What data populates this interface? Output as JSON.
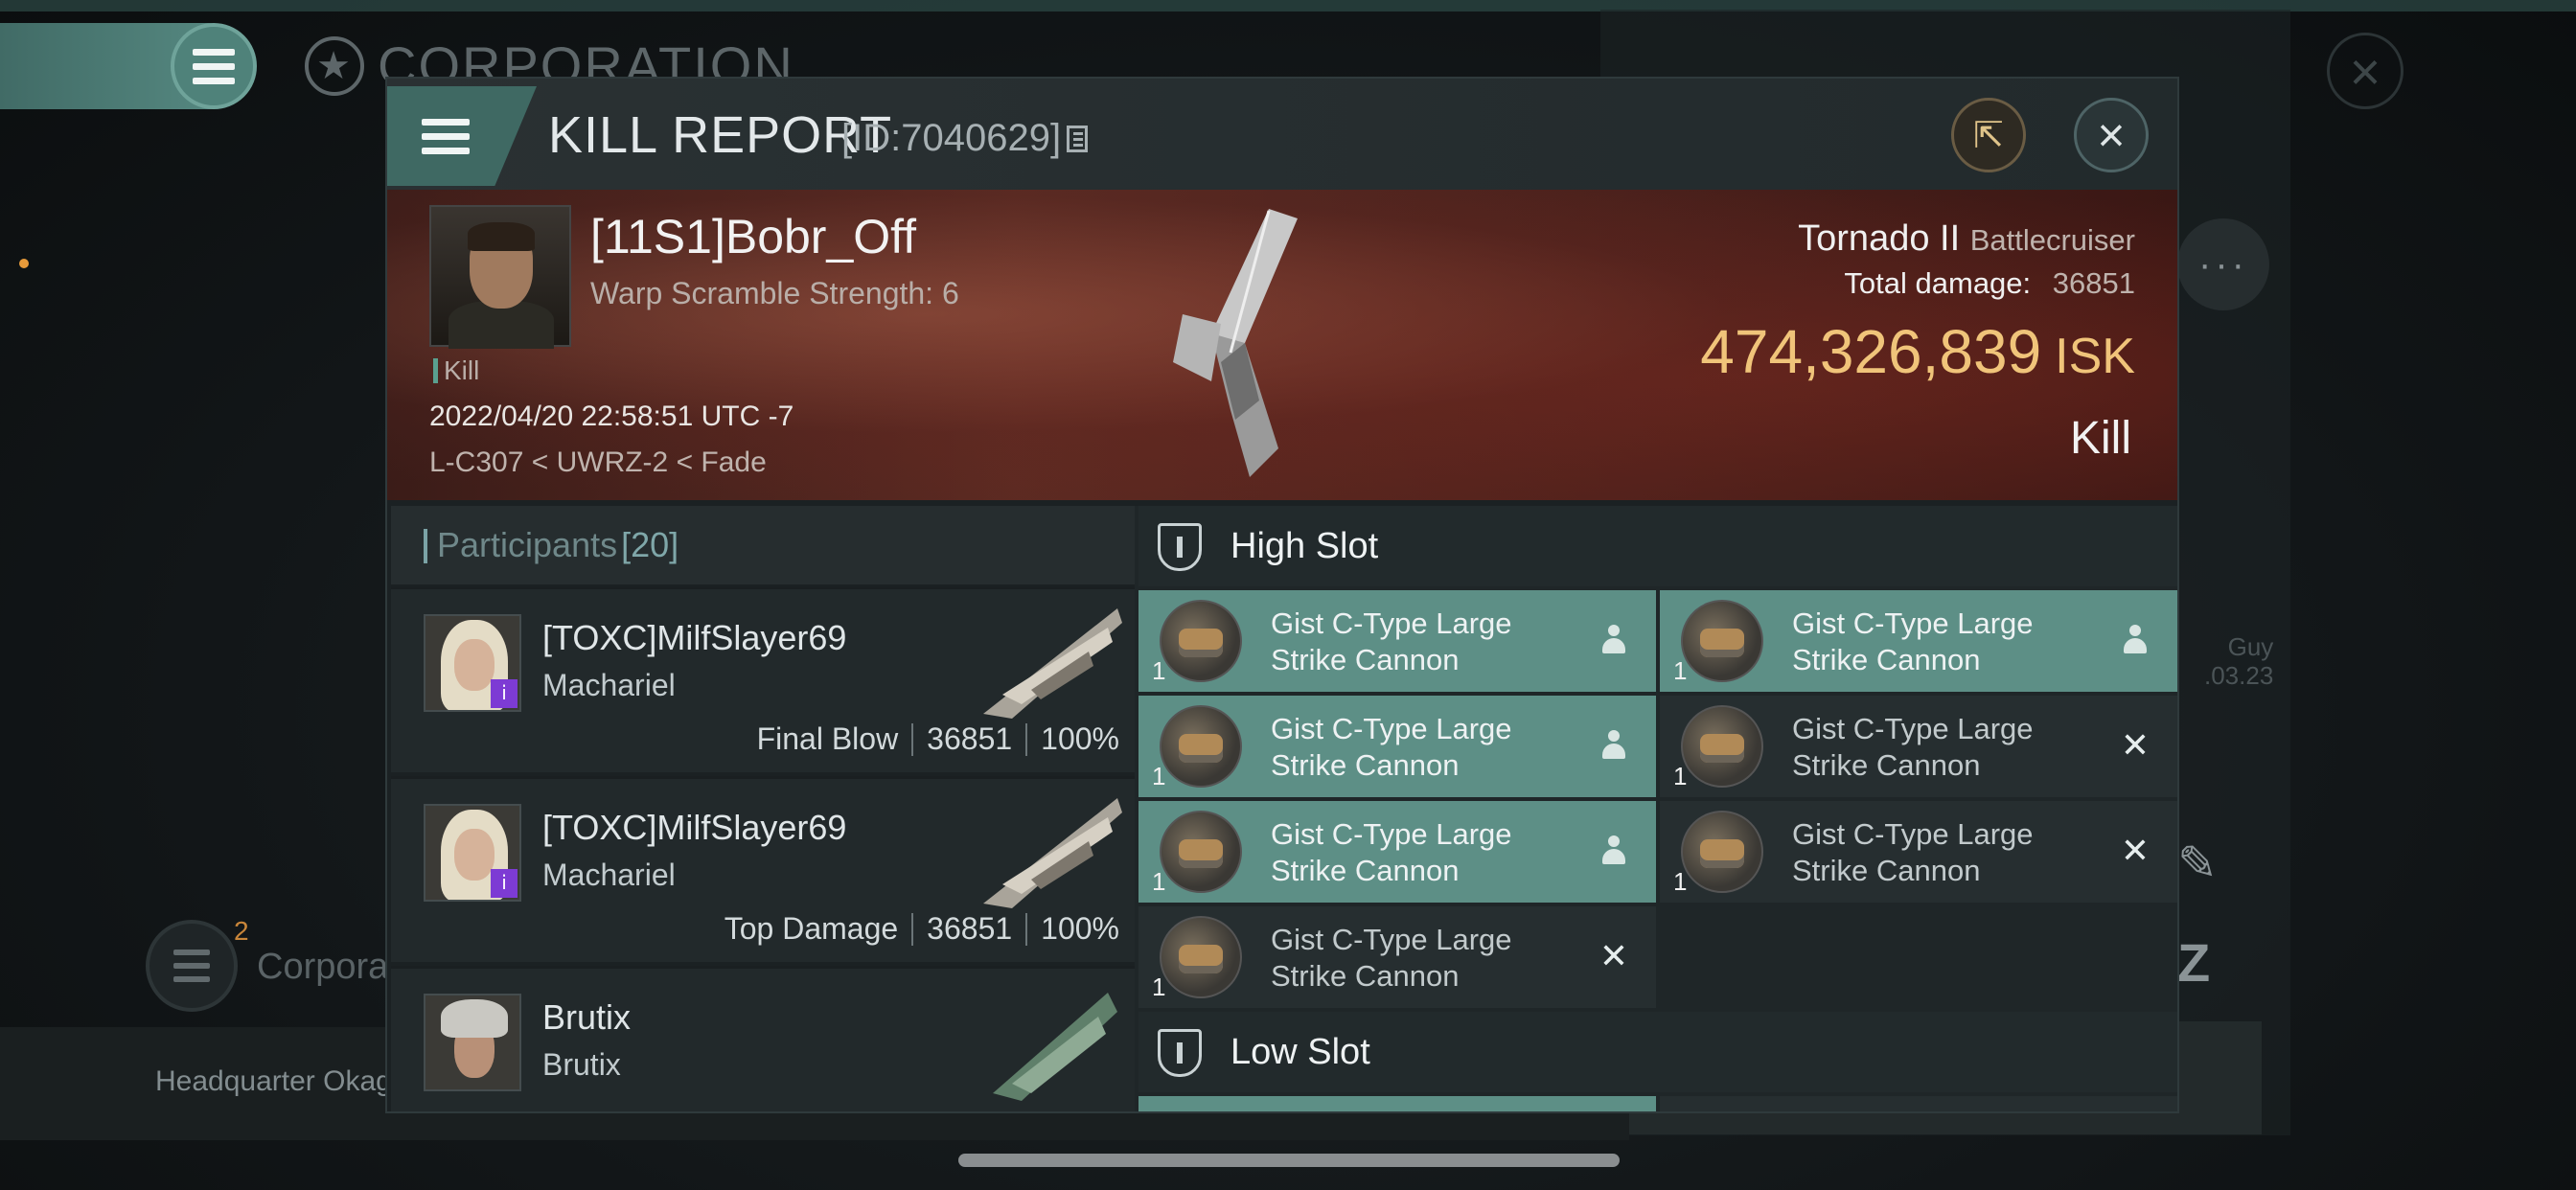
{
  "background": {
    "section_title": "CORPORATION",
    "corp_badge_count": "2",
    "corp_label": "Corpora",
    "headquarter_text": "Headquarter Okag",
    "side_text_line1": "Guy",
    "side_text_line2": ".03.23"
  },
  "kill_report": {
    "title": "KILL REPORT",
    "report_id": "[ID:7040629]",
    "victim": {
      "name": "[11S1]Bobr_Off",
      "warp_scramble": "Warp Scramble Strength: 6",
      "tag": "Kill",
      "datetime": "2022/04/20 22:58:51 UTC -7",
      "location": "L-C307 < UWRZ-2 < Fade"
    },
    "ship": {
      "name": "Tornado II",
      "class": "Battlecruiser",
      "total_damage_label": "Total damage:",
      "total_damage": "36851",
      "isk_value": "474,326,839",
      "isk_unit": "ISK",
      "outcome": "Kill"
    },
    "participants": {
      "label": "Participants",
      "count": "[20]",
      "rows": [
        {
          "name": "[TOXC]MilfSlayer69",
          "ship": "Machariel",
          "role": "Final Blow",
          "damage": "36851",
          "percent": "100%"
        },
        {
          "name": "[TOXC]MilfSlayer69",
          "ship": "Machariel",
          "role": "Top Damage",
          "damage": "36851",
          "percent": "100%"
        },
        {
          "name": "Brutix",
          "ship": "Brutix",
          "role": "",
          "damage": "",
          "percent": ""
        }
      ]
    },
    "fitting": {
      "high_slot_label": "High Slot",
      "low_slot_label": "Low Slot",
      "high_slot_modules": [
        {
          "line1": "Gist C-Type Large",
          "line2": "Strike Cannon",
          "qty": "1",
          "state": "dropped"
        },
        {
          "line1": "Gist C-Type Large",
          "line2": "Strike Cannon",
          "qty": "1",
          "state": "dropped"
        },
        {
          "line1": "Gist C-Type Large",
          "line2": "Strike Cannon",
          "qty": "1",
          "state": "dropped"
        },
        {
          "line1": "Gist C-Type Large",
          "line2": "Strike Cannon",
          "qty": "1",
          "state": "destroyed"
        },
        {
          "line1": "Gist C-Type Large",
          "line2": "Strike Cannon",
          "qty": "1",
          "state": "dropped"
        },
        {
          "line1": "Gist C-Type Large",
          "line2": "Strike Cannon",
          "qty": "1",
          "state": "destroyed"
        },
        {
          "line1": "Gist C-Type Large",
          "line2": "Strike Cannon",
          "qty": "1",
          "state": "destroyed"
        }
      ]
    }
  },
  "colors": {
    "accent_teal": "#5d8f86",
    "isk_gold": "#f0c47a",
    "panel_dark": "#1b2123"
  }
}
